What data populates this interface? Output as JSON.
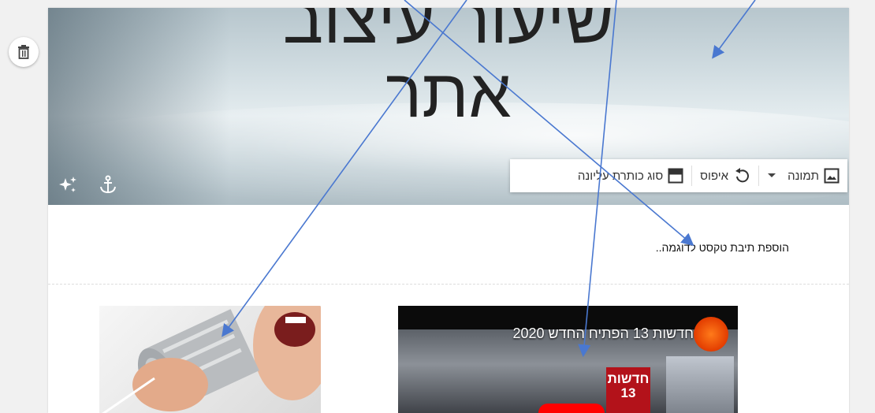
{
  "header": {
    "title_line1": "שיעור עיצוב",
    "title_line2": "אתר"
  },
  "toolbar": {
    "image_label": "תמונה",
    "reset_label": "איפוס",
    "header_type_label": "סוג כותרת עליונה"
  },
  "content": {
    "sample_text": "הוספת תיבת טקסט לדוגמה.."
  },
  "video": {
    "title": "חדשות 13 הפתיח החדש 2020",
    "badge_line1": "חדשות",
    "badge_line2": "13"
  },
  "colors": {
    "arrow": "#4a78d0",
    "badge_red": "#b3121a"
  },
  "icons": [
    "trash-icon",
    "sparkle-icon",
    "anchor-icon",
    "image-icon",
    "dropdown-arrow-icon",
    "reset-icon",
    "header-type-icon"
  ]
}
